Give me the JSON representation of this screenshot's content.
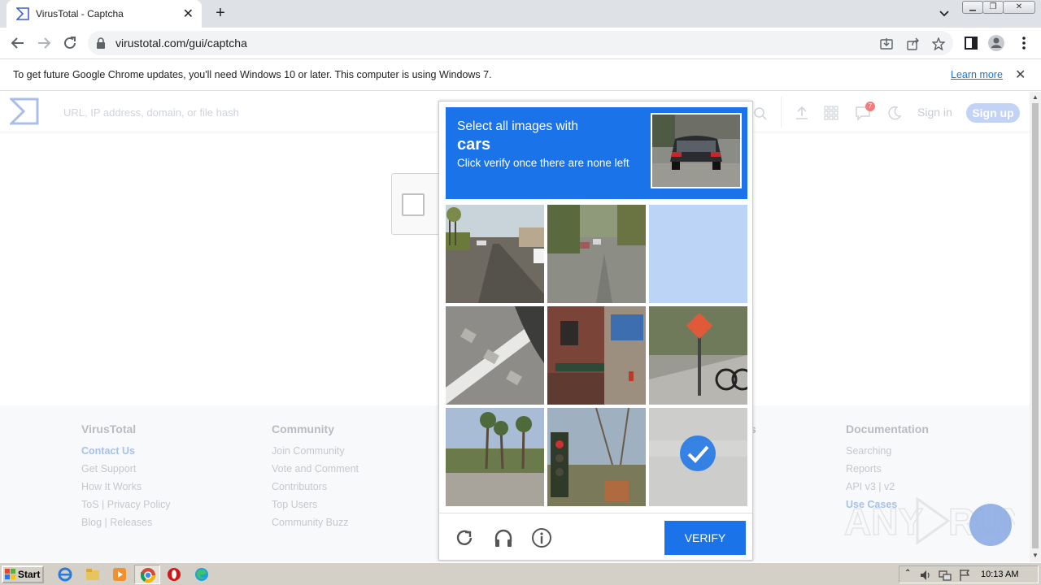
{
  "browser": {
    "tab_title": "VirusTotal - Captcha",
    "url": "virustotal.com/gui/captcha",
    "infobar_message": "To get future Google Chrome updates, you'll need Windows 10 or later. This computer is using Windows 7.",
    "infobar_link": "Learn more"
  },
  "vt": {
    "search_placeholder": "URL, IP address, domain, or file hash",
    "notification_count": "7",
    "sign_in": "Sign in",
    "sign_up": "Sign up"
  },
  "footer": {
    "columns": [
      {
        "heading": "VirusTotal",
        "links": [
          "Contact Us",
          "Get Support",
          "How It Works",
          "ToS | Privacy Policy",
          "Blog | Releases"
        ]
      },
      {
        "heading": "Community",
        "links": [
          "Join Community",
          "Vote and Comment",
          "Contributors",
          "Top Users",
          "Community Buzz"
        ]
      },
      {
        "heading": "Documentation",
        "links": [
          "Searching",
          "Reports",
          "API v3 | v2",
          "Use Cases"
        ]
      }
    ],
    "partial_heading_fragment": "s"
  },
  "captcha": {
    "line1": "Select all images with",
    "target": "cars",
    "line3": "Click verify once there are none left",
    "verify_label": "VERIFY",
    "selected_tiles": [
      8
    ],
    "loading_tiles": [
      2
    ]
  },
  "taskbar": {
    "start_label": "Start",
    "clock": "10:13 AM"
  },
  "watermark": "ANY RUN"
}
